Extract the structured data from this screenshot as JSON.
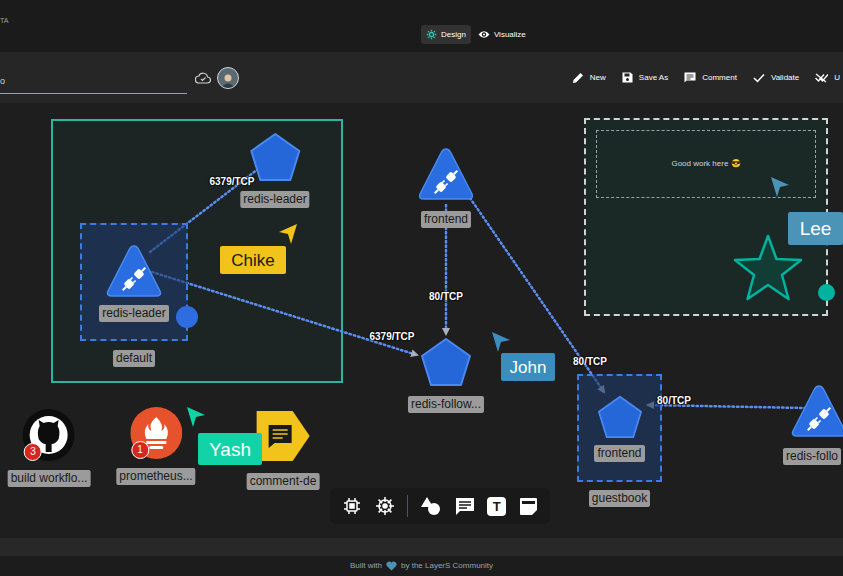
{
  "app": {
    "title_fragment": "TA"
  },
  "view_tabs": [
    {
      "label": "Design",
      "selected": true
    },
    {
      "label": "Visualize",
      "selected": false
    }
  ],
  "design_bar": {
    "design_name": "o",
    "actions": [
      {
        "label": "New"
      },
      {
        "label": "Save As"
      },
      {
        "label": "Comment"
      },
      {
        "label": "Validate"
      },
      {
        "label": "U"
      }
    ]
  },
  "canvas": {
    "nodes": [
      {
        "kind": "service",
        "label": "redis-leader",
        "selected": false
      },
      {
        "kind": "deployment",
        "label": "redis-leader",
        "selected": true,
        "namespace": "default"
      },
      {
        "kind": "deployment",
        "label": "frontend",
        "selected": false
      },
      {
        "kind": "service",
        "label": "redis-follow...",
        "selected": false
      },
      {
        "kind": "service",
        "label": "frontend",
        "selected": true,
        "namespace": "guestbook"
      },
      {
        "kind": "deployment",
        "label": "redis-follo",
        "selected": false
      },
      {
        "kind": "github",
        "label": "build workflo...",
        "selected": false,
        "badge": "3"
      },
      {
        "kind": "prometheus",
        "label": "prometheus...",
        "selected": false,
        "badge": "1"
      },
      {
        "kind": "comment",
        "label": "comment-de",
        "selected": false
      }
    ],
    "edges": [
      {
        "label": "6379/TCP"
      },
      {
        "label": "6379/TCP"
      },
      {
        "label": "80/TCP"
      },
      {
        "label": "80/TCP"
      },
      {
        "label": "80/TCP"
      }
    ],
    "cursors": [
      {
        "name": "Chike",
        "color": "#f2c31b"
      },
      {
        "name": "John",
        "color": "#3b8dbd"
      },
      {
        "name": "Yash",
        "color": "#12d3a8"
      },
      {
        "name": "Lee",
        "color": "#4b93b7"
      }
    ],
    "comment_note": {
      "text": "Good work here 😎"
    }
  },
  "dock": {
    "text_tool": "T"
  },
  "footer": {
    "before": "Built with",
    "after": "by the LayerS Community"
  }
}
